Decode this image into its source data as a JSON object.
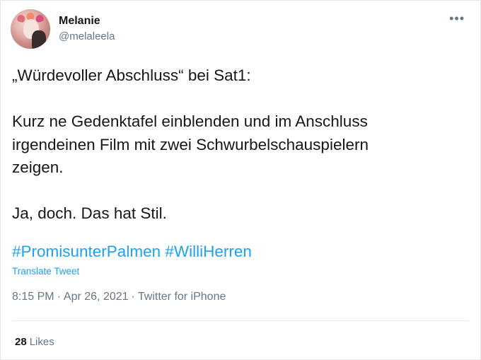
{
  "user": {
    "display_name": "Melanie",
    "handle": "@melaleela"
  },
  "more_icon": "more-horizontal-icon",
  "tweet": {
    "text": "„Würdevoller Abschluss“ bei Sat1:\n\nKurz ne Gedenktafel einblenden und im Anschluss\nirgendeinen Film mit zwei Schwurbelschauspielern\nzeigen.\n\nJa, doch. Das hat Stil.",
    "hashtags": [
      "#PromisunterPalmen",
      "#WilliHerren"
    ]
  },
  "translate_label": "Translate Tweet",
  "meta": {
    "time": "8:15 PM",
    "date": "Apr 26, 2021",
    "source": "Twitter for iPhone"
  },
  "stats": {
    "likes_count": "28",
    "likes_label": "Likes"
  },
  "colors": {
    "link": "#1da1f2",
    "text": "#14171a",
    "secondary": "#657786"
  }
}
